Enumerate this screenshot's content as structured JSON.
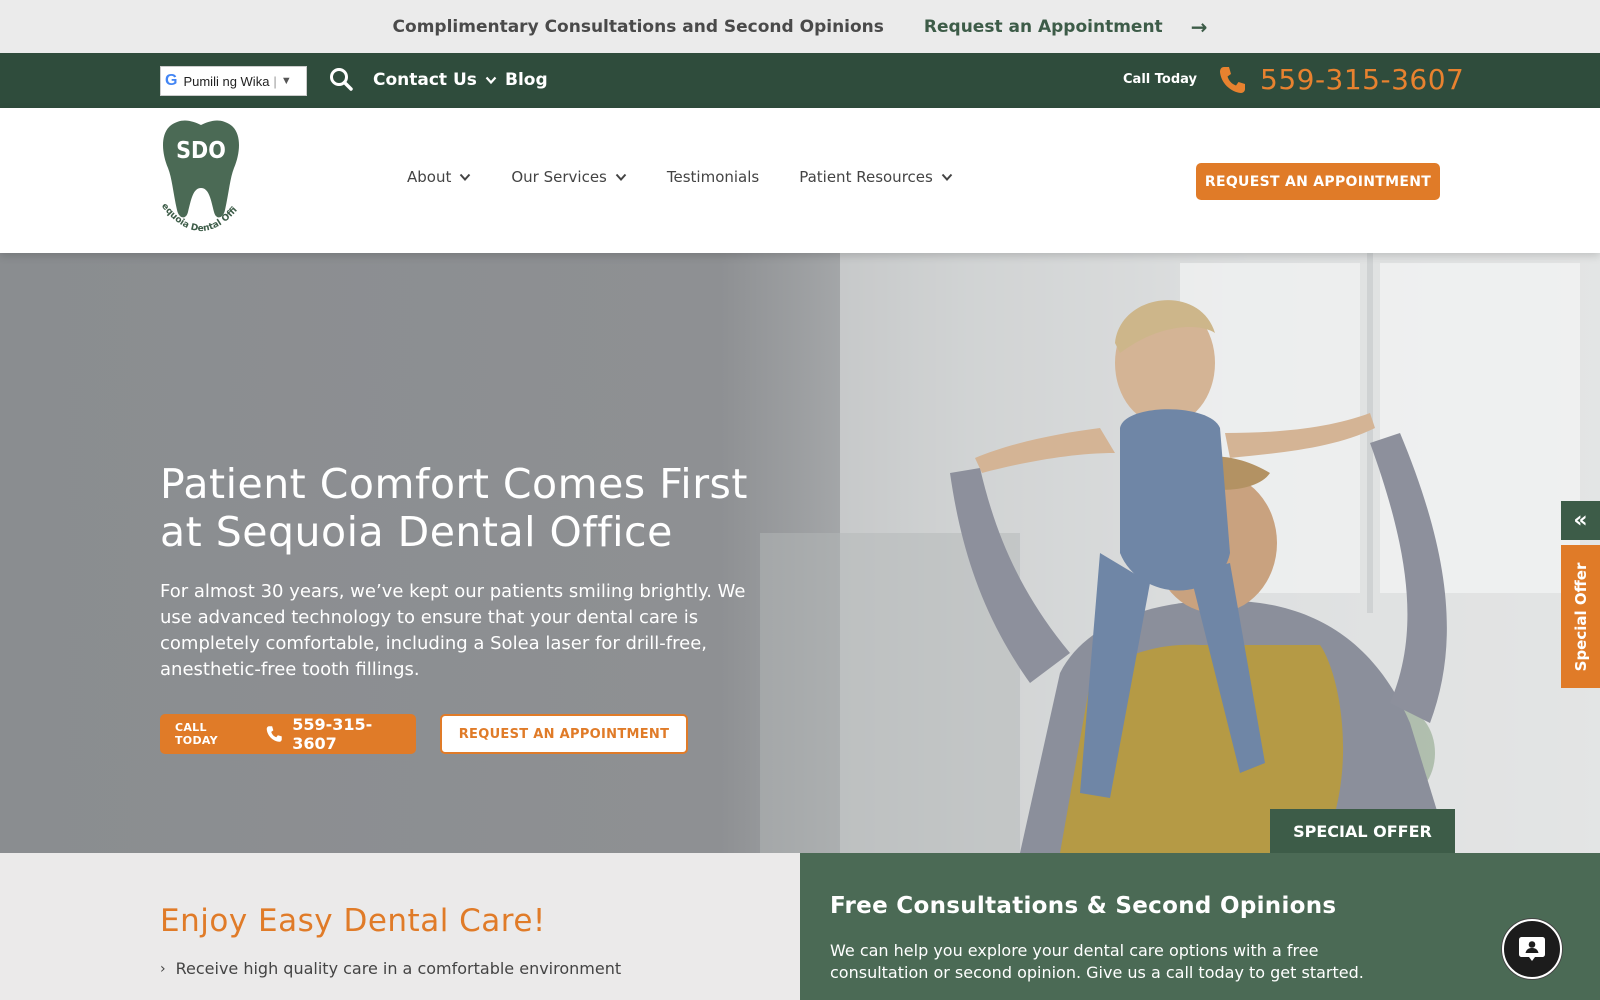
{
  "announcement": {
    "message": "Complimentary Consultations and Second Opinions",
    "link": "Request an Appointment",
    "arrow": "→"
  },
  "utility": {
    "language_label": "Pumili ng Wika",
    "language_sep": "|",
    "language_caret": "▼",
    "google_g": "G",
    "contact": "Contact Us",
    "blog": "Blog",
    "call_today": "Call Today",
    "phone": "559-315-3607",
    "icons": [
      "google-icon",
      "search-icon",
      "chevron-down-icon",
      "phone-icon"
    ]
  },
  "nav": {
    "logo_text": "SDO",
    "logo_subtext": "Sequoia Dental Office",
    "items": [
      {
        "label": "About",
        "has_menu": true
      },
      {
        "label": "Our Services",
        "has_menu": true
      },
      {
        "label": "Testimonials",
        "has_menu": false
      },
      {
        "label": "Patient Resources",
        "has_menu": true
      }
    ],
    "cta": "REQUEST AN APPOINTMENT"
  },
  "hero": {
    "title_line1": "Patient Comfort Comes First",
    "title_line2": "at Sequoia Dental Office",
    "text": "For almost 30 years, we’ve kept our patients smiling brightly. We use advanced technology to ensure that your dental care is completely comfortable, including a Solea laser for drill-free, anesthetic-free tooth fillings.",
    "call_label": "CALL TODAY",
    "call_phone": "559-315-3607",
    "appointment": "REQUEST AN APPOINTMENT",
    "special_tab": "SPECIAL OFFER"
  },
  "side": {
    "toggle": "«",
    "offer": "Special Offer"
  },
  "sections": {
    "left_title": "Enjoy Easy Dental Care!",
    "left_bullet": "›",
    "left_item": "Receive high quality care in a comfortable environment",
    "right_title": "Free Consultations & Second Opinions",
    "right_text": "We can help you explore your dental care options with a free consultation or second opinion. Give us a call today to get started."
  },
  "colors": {
    "green_dark": "#2f4c3c",
    "green": "#3d5c48",
    "orange": "#e07b28",
    "light_gray": "#ebebeb"
  }
}
